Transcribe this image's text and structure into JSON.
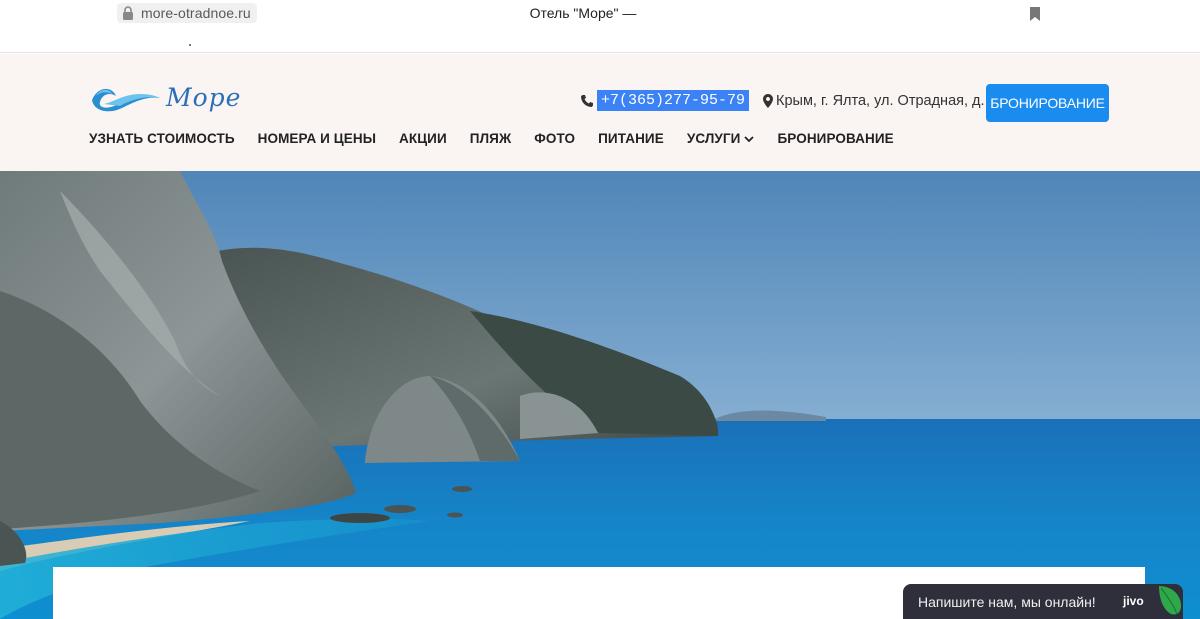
{
  "browser": {
    "url": "more-otradnoe.ru",
    "tab_title": "Отель \"Море\" —"
  },
  "header": {
    "logo_text": "Море",
    "phone": "+7(365)277-95-79",
    "address": "Крым, г. Ялта, ул. Отрадная, д. 28",
    "book_button": "БРОНИРОВАНИЕ"
  },
  "nav": {
    "items": [
      {
        "label": "УЗНАТЬ СТОИМОСТЬ"
      },
      {
        "label": "НОМЕРА И ЦЕНЫ"
      },
      {
        "label": "АКЦИИ"
      },
      {
        "label": "ПЛЯЖ"
      },
      {
        "label": "ФОТО"
      },
      {
        "label": "ПИТАНИЕ"
      },
      {
        "label": "УСЛУГИ"
      },
      {
        "label": "БРОНИРОВАНИЕ"
      }
    ]
  },
  "chat": {
    "text": "Напишите нам, мы онлайн!",
    "brand": "jivo"
  },
  "colors": {
    "accent": "#1a8cf0",
    "header_bg": "#faf4f3",
    "chat_bg": "#2f2f3b",
    "selection": "#3b82f6"
  }
}
